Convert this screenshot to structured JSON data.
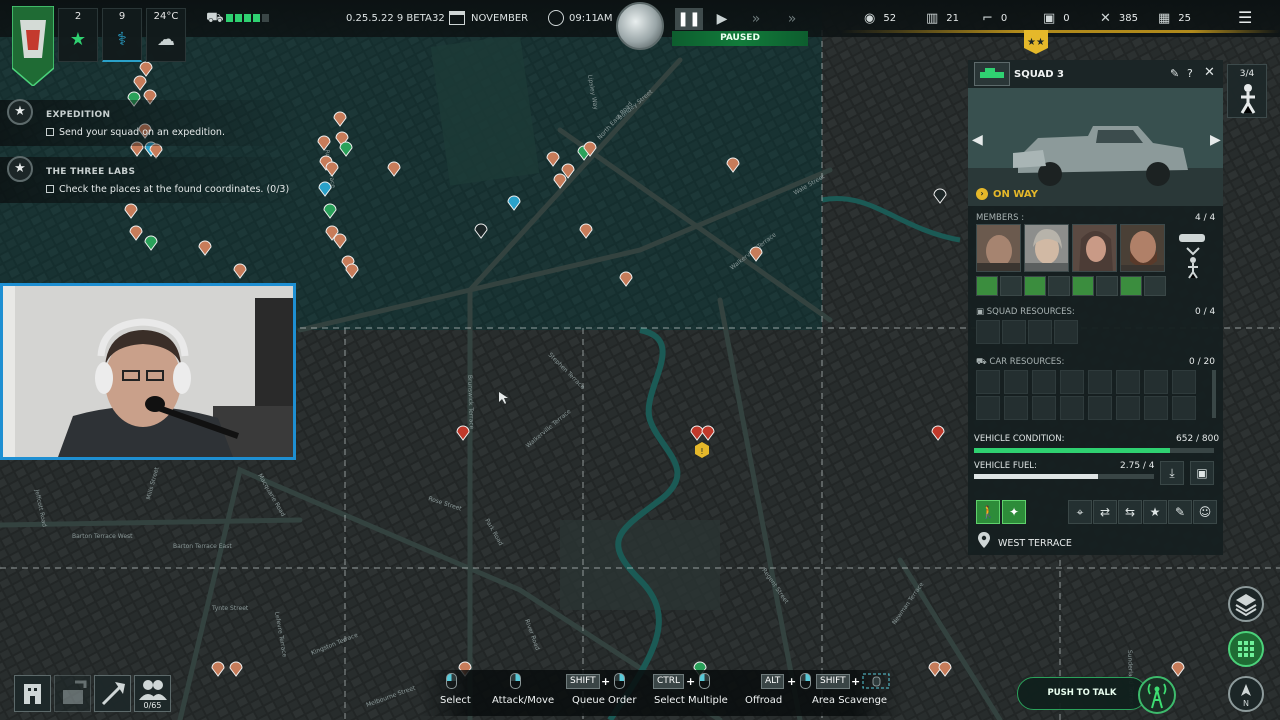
{
  "top_bar": {
    "stats": [
      {
        "value": "2",
        "icon": "star-icon"
      },
      {
        "value": "9",
        "icon": "stethoscope-icon"
      },
      {
        "value": "24°C",
        "icon": "cloud-icon"
      }
    ],
    "version": "0.25.5.22 9 BETA",
    "day": "32",
    "month": "NOVEMBER",
    "time": "09:11",
    "ampm": "AM",
    "paused_label": "PAUSED",
    "resources": [
      {
        "icon": "food-icon",
        "value": "52"
      },
      {
        "icon": "ammo-icon",
        "value": "21"
      },
      {
        "icon": "gun-icon",
        "value": "0"
      },
      {
        "icon": "medkit-icon",
        "value": "0"
      },
      {
        "icon": "tools-icon",
        "value": "385"
      },
      {
        "icon": "materials-icon",
        "value": "25"
      }
    ]
  },
  "objectives": [
    {
      "title": "EXPEDITION",
      "task": "Send your squad on an expedition."
    },
    {
      "title": "THE THREE LABS",
      "task": "Check the places at the found coordinates. (0/3)"
    }
  ],
  "map_labels": [
    "North East Road",
    "Wale Street",
    "Walkerville Terrace",
    "Lipsley Way",
    "Stephen Terrace",
    "Walkerville Terrace",
    "Brunswick Terrace",
    "Rose Street",
    "Park Road",
    "Barton Terrace West",
    "Barton Terrace East",
    "Macquarie Road",
    "Jeffcott Road",
    "Mills Street",
    "Tynte Street",
    "Lefevre Terrace",
    "Kingston Terrace",
    "Melbourne Street",
    "Regent Street",
    "River Road",
    "Bundey Street",
    "Robe Terrace",
    "Newman Terrace",
    "Sunderland Terrace"
  ],
  "squad_panel": {
    "name": "SQUAD 3",
    "status": "ON WAY",
    "members_label": "MEMBERS :",
    "members_count": "4 / 4",
    "squad_resources_label": "SQUAD RESOURCES:",
    "squad_resources_count": "0 / 4",
    "car_resources_label": "CAR RESOURCES:",
    "car_resources_count": "0 / 20",
    "vehicle_condition_label": "VEHICLE CONDITION:",
    "vehicle_condition_value": "652 / 800",
    "vehicle_condition_fraction": 0.815,
    "vehicle_fuel_label": "VEHICLE FUEL:",
    "vehicle_fuel_value": "2.75 / 4",
    "vehicle_fuel_fraction": 0.6875,
    "location": "WEST TERRACE",
    "squad_tab": "3/4"
  },
  "bottom": {
    "survivors_count": "0/65",
    "hints": [
      {
        "label": "Select"
      },
      {
        "label": "Attack/Move"
      },
      {
        "label": "Queue Order",
        "key": "SHIFT"
      },
      {
        "label": "Select Multiple",
        "key": "CTRL"
      },
      {
        "label": "Offroad",
        "key": "ALT"
      },
      {
        "label": "Area Scavenge",
        "key": "SHIFT"
      }
    ],
    "push_to_talk": "PUSH TO TALK",
    "compass": "N"
  },
  "colors": {
    "accent_green": "#2fd171",
    "paused_green": "#127c3b",
    "warning_yellow": "#e5b82a",
    "marker_red": "#c0392b",
    "webcam_border": "#1e8fd2"
  }
}
